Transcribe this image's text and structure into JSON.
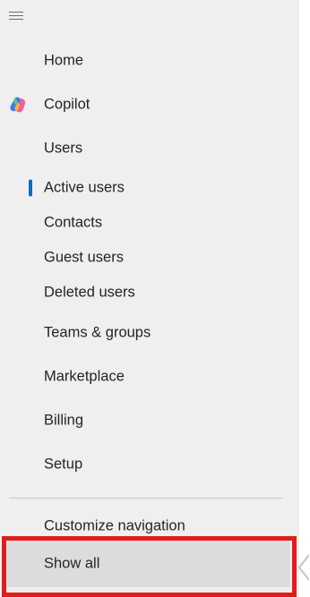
{
  "nav": {
    "items": [
      {
        "label": "Home"
      },
      {
        "label": "Copilot",
        "icon": "copilot-icon"
      },
      {
        "label": "Users"
      },
      {
        "label": "Active users",
        "selected": true
      },
      {
        "label": "Contacts"
      },
      {
        "label": "Guest users"
      },
      {
        "label": "Deleted users"
      },
      {
        "label": "Teams & groups"
      },
      {
        "label": "Marketplace"
      },
      {
        "label": "Billing"
      },
      {
        "label": "Setup"
      }
    ],
    "customize_label": "Customize navigation",
    "show_all_label": "Show all"
  },
  "colors": {
    "nav_background": "#efefef",
    "selected_indicator": "#0f6cbd",
    "highlight_border": "#e01c1c",
    "show_all_background": "#dcdcdc"
  }
}
